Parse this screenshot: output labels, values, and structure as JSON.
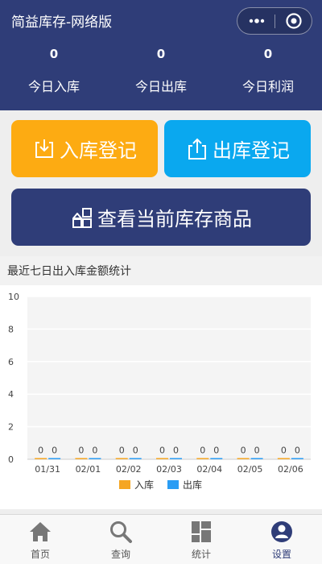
{
  "header": {
    "title": "简益库存-网络版",
    "stats": [
      {
        "value": "0",
        "label": "今日入库"
      },
      {
        "value": "0",
        "label": "今日出库"
      },
      {
        "value": "0",
        "label": "今日利润"
      }
    ]
  },
  "actions": {
    "stock_in_label": "入库登记",
    "stock_out_label": "出库登记",
    "view_stock_label": "查看当前库存商品"
  },
  "chart_section": {
    "title": "最近七日出入库金额统计"
  },
  "chart_data": {
    "type": "bar",
    "categories": [
      "01/31",
      "02/01",
      "02/02",
      "02/03",
      "02/04",
      "02/05",
      "02/06"
    ],
    "series": [
      {
        "name": "入库",
        "values": [
          0,
          0,
          0,
          0,
          0,
          0,
          0
        ],
        "color": "#f5a623"
      },
      {
        "name": "出库",
        "values": [
          0,
          0,
          0,
          0,
          0,
          0,
          0
        ],
        "color": "#2a9df4"
      }
    ],
    "yticks": [
      0,
      2,
      4,
      6,
      8,
      10
    ],
    "ylim": [
      0,
      10
    ],
    "grid": true,
    "data_labels": true,
    "legend": "bottom-center"
  },
  "tabbar": {
    "items": [
      {
        "label": "首页",
        "icon": "home-icon"
      },
      {
        "label": "查询",
        "icon": "search-icon"
      },
      {
        "label": "统计",
        "icon": "grid-icon"
      },
      {
        "label": "设置",
        "icon": "user-icon",
        "active": true
      }
    ],
    "active_color": "#2f3d78"
  },
  "colors": {
    "header_bg": "#2f3d78",
    "stock_in_bg": "#fdab12",
    "stock_out_bg": "#0aa8ef",
    "view_stock_bg": "#2f3d78"
  }
}
